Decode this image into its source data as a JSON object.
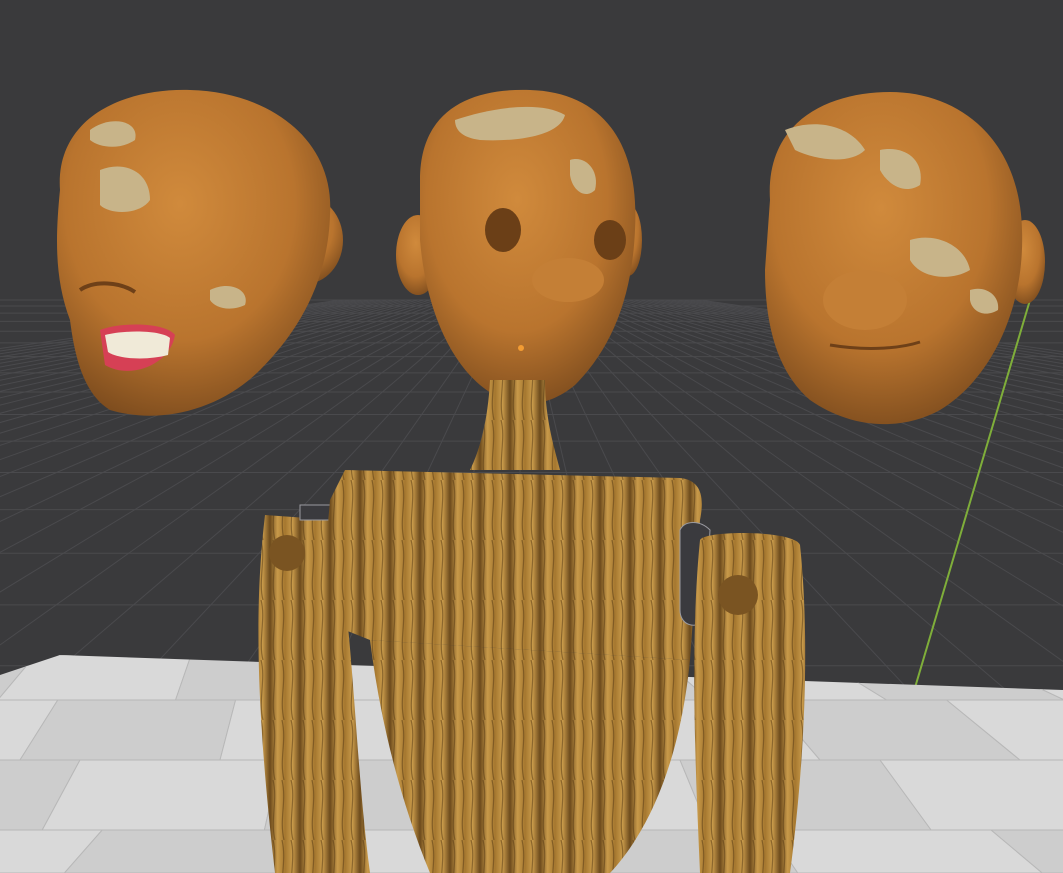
{
  "viewport": {
    "background_color": "#3a3a3c",
    "grid_line_color": "#4a4a4d",
    "y_axis_color": "#7fae3a",
    "origin_marker_color": "#f39c33"
  },
  "floor": {
    "tile_color_light": "#d9d9d9",
    "tile_color_dark": "#cdcdcd",
    "tile_edge_color": "#b8b8b8"
  },
  "materials": {
    "head_paint": "#b9742e",
    "head_paint_highlight": "#d08a3c",
    "head_paint_shadow": "#7a4a1d",
    "peeled_paint": "#c8b489",
    "teeth": "#f0ead8",
    "gums": "#d64055",
    "wood_base": "#a5772f",
    "wood_dark": "#6c4a1c",
    "wood_light": "#c89a4a",
    "metal_ring": "#3a3a3e"
  },
  "objects": [
    {
      "name": "head-open-mouth",
      "kind": "head"
    },
    {
      "name": "head-on-body",
      "kind": "head"
    },
    {
      "name": "head-closed-mouth",
      "kind": "head"
    },
    {
      "name": "wooden-mannequin-body",
      "kind": "body"
    }
  ]
}
